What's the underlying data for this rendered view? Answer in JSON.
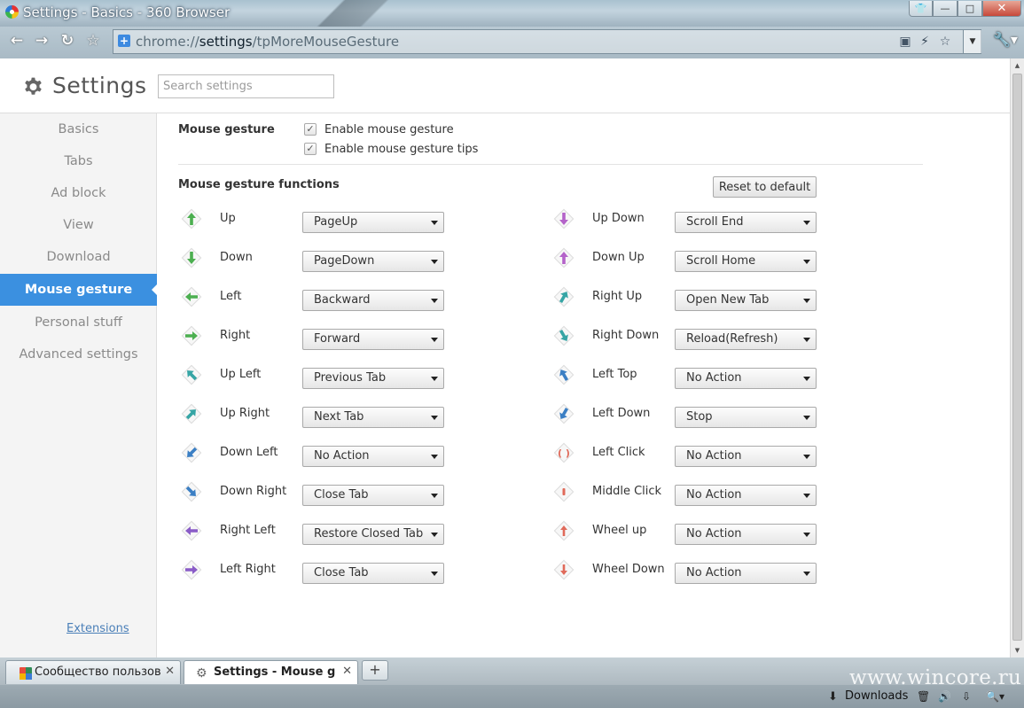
{
  "window": {
    "title": "Settings - Basics - 360 Browser"
  },
  "omnibox": {
    "url_scheme": "chrome://",
    "url_host": "settings",
    "url_path": "/tpMoreMouseGesture"
  },
  "header": {
    "title": "Settings",
    "search_placeholder": "Search settings"
  },
  "sidebar": {
    "items": [
      {
        "label": "Basics"
      },
      {
        "label": "Tabs"
      },
      {
        "label": "Ad block"
      },
      {
        "label": "View"
      },
      {
        "label": "Download"
      },
      {
        "label": "Mouse gesture",
        "active": true
      },
      {
        "label": "Personal stuff"
      },
      {
        "label": "Advanced settings"
      }
    ],
    "extensions_link": "Extensions"
  },
  "mouse_gesture": {
    "heading": "Mouse gesture",
    "enable_label": "Enable mouse gesture",
    "enable_checked": true,
    "tips_label": "Enable mouse gesture tips",
    "tips_checked": true
  },
  "functions": {
    "heading": "Mouse gesture functions",
    "reset_label": "Reset to default",
    "left": [
      {
        "gesture": "Up",
        "action": "PageUp",
        "icon": "arrow-up-icon",
        "color": "#4caf50"
      },
      {
        "gesture": "Down",
        "action": "PageDown",
        "icon": "arrow-down-icon",
        "color": "#4caf50"
      },
      {
        "gesture": "Left",
        "action": "Backward",
        "icon": "arrow-left-icon",
        "color": "#4caf50"
      },
      {
        "gesture": "Right",
        "action": "Forward",
        "icon": "arrow-right-icon",
        "color": "#4caf50"
      },
      {
        "gesture": "Up Left",
        "action": "Previous Tab",
        "icon": "arrow-up-left-icon",
        "color": "#36a5a5"
      },
      {
        "gesture": "Up Right",
        "action": "Next Tab",
        "icon": "arrow-up-right-icon",
        "color": "#36a5a5"
      },
      {
        "gesture": "Down Left",
        "action": "No Action",
        "icon": "arrow-down-left-icon",
        "color": "#3b7fc4"
      },
      {
        "gesture": "Down Right",
        "action": "Close Tab",
        "icon": "arrow-down-right-icon",
        "color": "#3b7fc4"
      },
      {
        "gesture": "Right Left",
        "action": "Restore Closed Tab",
        "icon": "arrow-right-left-icon",
        "color": "#8a5cc7"
      },
      {
        "gesture": "Left Right",
        "action": "Close Tab",
        "icon": "arrow-left-right-icon",
        "color": "#8a5cc7"
      }
    ],
    "right": [
      {
        "gesture": "Up Down",
        "action": "Scroll End",
        "icon": "arrow-up-down-icon",
        "color": "#b463c9"
      },
      {
        "gesture": "Down Up",
        "action": "Scroll Home",
        "icon": "arrow-down-up-icon",
        "color": "#b463c9"
      },
      {
        "gesture": "Right Up",
        "action": "Open New Tab",
        "icon": "arrow-right-up-icon",
        "color": "#36a5a5"
      },
      {
        "gesture": "Right Down",
        "action": "Reload(Refresh)",
        "icon": "arrow-right-down-icon",
        "color": "#36a5a5"
      },
      {
        "gesture": "Left Top",
        "action": "No Action",
        "icon": "arrow-left-top-icon",
        "color": "#3b7fc4"
      },
      {
        "gesture": "Left Down",
        "action": "Stop",
        "icon": "arrow-left-down-icon",
        "color": "#3b7fc4"
      },
      {
        "gesture": "Left Click",
        "action": "No Action",
        "icon": "mouse-left-click-icon",
        "color": "#e06a5a"
      },
      {
        "gesture": "Middle Click",
        "action": "No Action",
        "icon": "mouse-middle-click-icon",
        "color": "#e06a5a"
      },
      {
        "gesture": "Wheel up",
        "action": "No Action",
        "icon": "wheel-up-icon",
        "color": "#e06a5a"
      },
      {
        "gesture": "Wheel Down",
        "action": "No Action",
        "icon": "wheel-down-icon",
        "color": "#e06a5a"
      }
    ]
  },
  "tabs": [
    {
      "title": "Сообщество пользоват",
      "active": false
    },
    {
      "title": "Settings - Mouse gestu",
      "active": true
    }
  ],
  "status": {
    "downloads_label": "Downloads",
    "watermark": "www.wincore.ru"
  }
}
